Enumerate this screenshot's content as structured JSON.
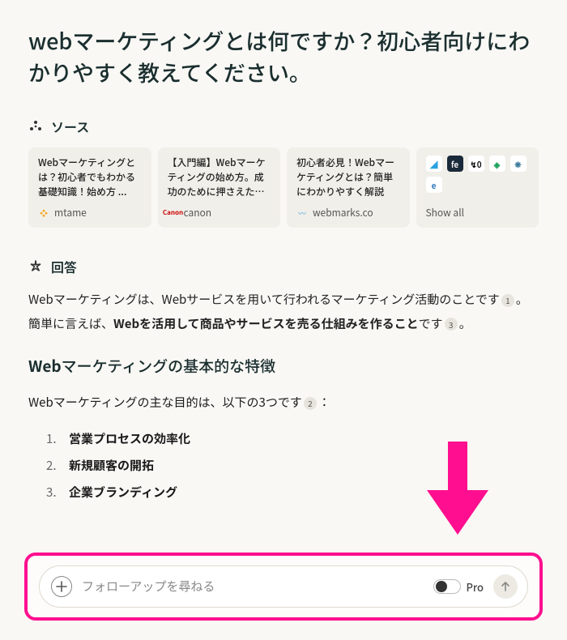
{
  "query": "webマーケティングとは何ですか？初心者向けにわかりやすく教えてください。",
  "sections": {
    "sources": {
      "label": "ソース"
    },
    "answer": {
      "label": "回答"
    }
  },
  "sources": [
    {
      "title": "Webマーケティングとは？初心者でもわかる基礎知識！始め方 ...",
      "favicon": "❖",
      "faviconColor": "#f5a623",
      "domain": "mtame"
    },
    {
      "title": "【入門編】Webマーケティングの始め方。成功のために押さえたい ...",
      "favicon": "Canon",
      "faviconColor": "#cc0000",
      "domain": "canon"
    },
    {
      "title": "初心者必見！Webマーケティングとは？簡単にわかりやすく解説",
      "favicon": "〰",
      "faviconColor": "#4aa3df",
      "domain": "webmarks.co"
    }
  ],
  "showAll": {
    "label": "Show all",
    "favicons": [
      {
        "txt": "◢",
        "bg": "#fff",
        "col": "#2aa0e0"
      },
      {
        "txt": "fe",
        "bg": "#1b2a3a",
        "col": "#fff"
      },
      {
        "txt": "↯0",
        "bg": "#fff",
        "col": "#000"
      },
      {
        "txt": "◈",
        "bg": "#fff",
        "col": "#1aa05a"
      },
      {
        "txt": "❋",
        "bg": "#fff",
        "col": "#3a7a9a"
      },
      {
        "txt": "e",
        "bg": "#fff",
        "col": "#1e6fb8"
      }
    ]
  },
  "answer": {
    "p1a": "Webマーケティングは、Webサービスを用いて行われるマーケティング活動のことです",
    "cite1": "1",
    "p1b": "。簡単に言えば、",
    "bold1": "Webを活用して商品やサービスを売る仕組みを作ること",
    "p1c": "です",
    "cite2": "3",
    "p1d": "。"
  },
  "h2": {
    "bold": "Web",
    "rest": "マーケティングの基本的な特徴"
  },
  "intro": {
    "text": "Webマーケティングの主な目的は、以下の3つです",
    "cite": "2",
    "colon": "："
  },
  "list": [
    {
      "num": "1.",
      "txt": "営業プロセスの効率化"
    },
    {
      "num": "2.",
      "txt": "新規顧客の開拓"
    },
    {
      "num": "3.",
      "txt": "企業ブランディング"
    }
  ],
  "followup": {
    "placeholder": "フォローアップを尋ねる",
    "proLabel": "Pro"
  }
}
